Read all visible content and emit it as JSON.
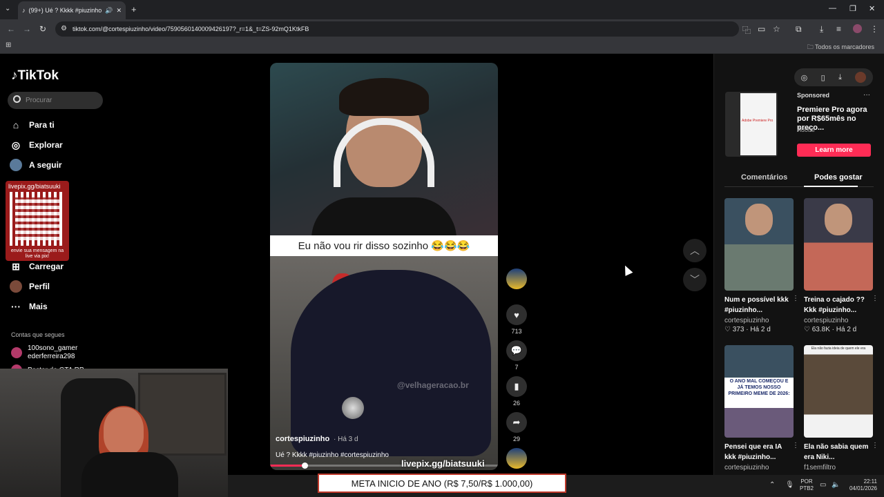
{
  "browser": {
    "tab_title": "(99+) Ué ? Kkkk #piuzinho #",
    "url": "tiktok.com/@cortespiuzinho/video/7590560140009426197?_r=1&_t=ZS-92mQ1KtkFB",
    "bookmarks_label": "Todos os marcadores"
  },
  "tiktok": {
    "logo": "TikTok",
    "search_placeholder": "Procurar",
    "nav": [
      {
        "label": "Para ti",
        "icon": "home-icon"
      },
      {
        "label": "Explorar",
        "icon": "compass-icon"
      },
      {
        "label": "A seguir",
        "icon": "avatar"
      },
      {
        "label": "Carregar",
        "icon": "plus-square-icon"
      },
      {
        "label": "Perfil",
        "icon": "avatar"
      },
      {
        "label": "Mais",
        "icon": "more-icon"
      }
    ],
    "following_header": "Contas que segues",
    "following": [
      {
        "name": "100sono_gamer",
        "sub": "ederferreira298"
      },
      {
        "name": "Pastor do GTA RP",
        "sub": ""
      }
    ]
  },
  "qr_overlay": {
    "top": "livepix.gg/biatsuuki",
    "bottom": "envie sua mensagem na live via pix!"
  },
  "video": {
    "caption_text": "Eu não vou rir disso sozinho 😂😂😂",
    "watermark": "@velhageracao.br",
    "author": "cortespiuzinho",
    "time": "· Há 3 d",
    "description": "Ué ? Kkkk #piuzinho #cortespiuzinho",
    "progress": 0.15,
    "likes": "713",
    "comments": "7",
    "saves": "26",
    "shares": "29"
  },
  "livepix_overlay": "livepix.gg/biatsuuki",
  "ad": {
    "sponsored": "Sponsored",
    "title": "Premiere Pro agora por R$65mês no preço...",
    "brand": "Adobe",
    "button": "Learn more",
    "thumb_text": "Adobe Premiere Pro"
  },
  "right_tabs": {
    "comments": "Comentários",
    "suggested": "Podes gostar"
  },
  "cards": [
    {
      "title": "Num e possível kkk #piuzinho...",
      "author": "cortespiuzinho",
      "stats": "♡ 373 · Há 2 d"
    },
    {
      "title": "Treina o cajado ?? Kkk #piuzinho...",
      "author": "cortespiuzinho",
      "stats": "♡ 63.8K · Há 2 d"
    },
    {
      "title": "Pensei que era IA kkk #piuzinho...",
      "author": "cortespiuzinho",
      "stats": "",
      "overlay": "O ANO MAL COMEÇOU E JÁ TEMOS NOSSO PRIMEIRO MEME DE 2026:"
    },
    {
      "title": "Ela não sabia quem era Niki...",
      "author": "f1semfiltro",
      "stats": "",
      "overlay": "Ela não fazia ideia de quem ele era"
    }
  ],
  "meta_banner": "META INICIO DE ANO (R$ 7,50/R$ 1.000,00)",
  "taskbar": {
    "lang1": "POR",
    "lang2": "PTB2",
    "time": "22:11",
    "date": "04/01/2026"
  }
}
